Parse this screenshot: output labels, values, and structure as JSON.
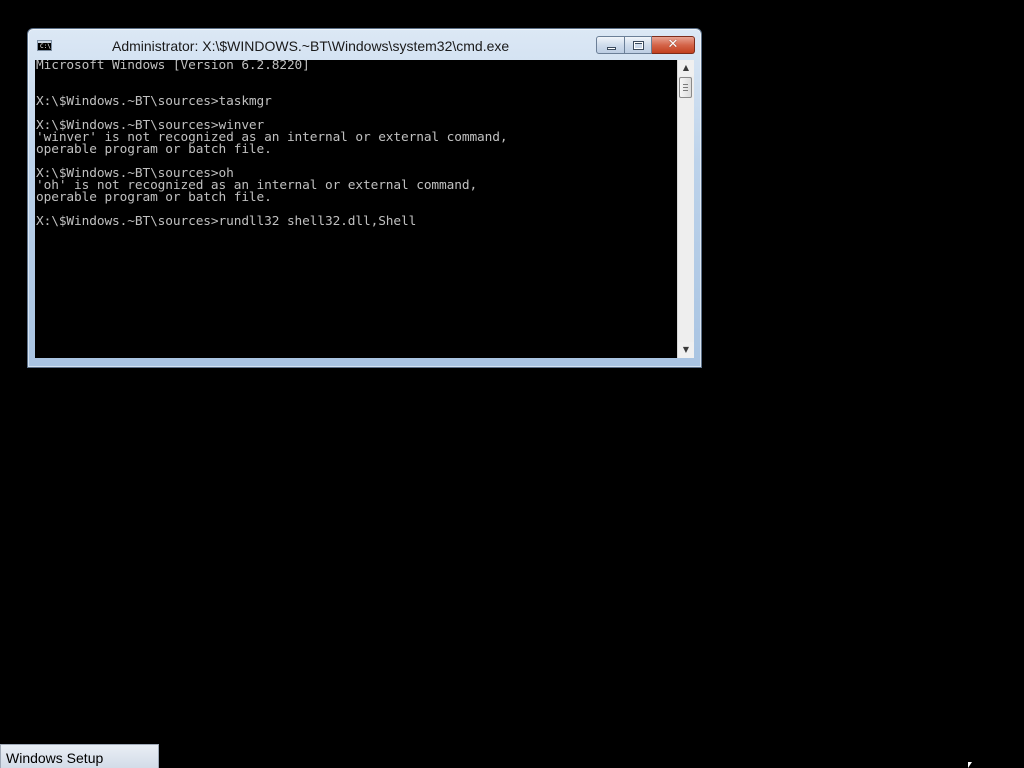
{
  "window": {
    "title": "Administrator: X:\\$WINDOWS.~BT\\Windows\\system32\\cmd.exe",
    "icon_name": "cmd-icon",
    "icon_text": "C:\\",
    "buttons": {
      "minimize": "minimize-icon",
      "maximize": "maximize-icon",
      "close": "close-icon"
    }
  },
  "console": {
    "foreground_color": "#c0c0c0",
    "background_color": "#000000",
    "lines": [
      "Microsoft Windows [Version 6.2.8220]",
      "",
      "",
      "X:\\$Windows.~BT\\sources>taskmgr",
      "",
      "X:\\$Windows.~BT\\sources>winver",
      "'winver' is not recognized as an internal or external command,",
      "operable program or batch file.",
      "",
      "X:\\$Windows.~BT\\sources>oh",
      "'oh' is not recognized as an internal or external command,",
      "operable program or batch file.",
      "",
      "X:\\$Windows.~BT\\sources>rundll32 shell32.dll,Shell"
    ]
  },
  "scrollbar": {
    "up_arrow": "▲",
    "down_arrow": "▼"
  },
  "taskbar": {
    "items": [
      {
        "label": "Windows Setup"
      }
    ]
  }
}
